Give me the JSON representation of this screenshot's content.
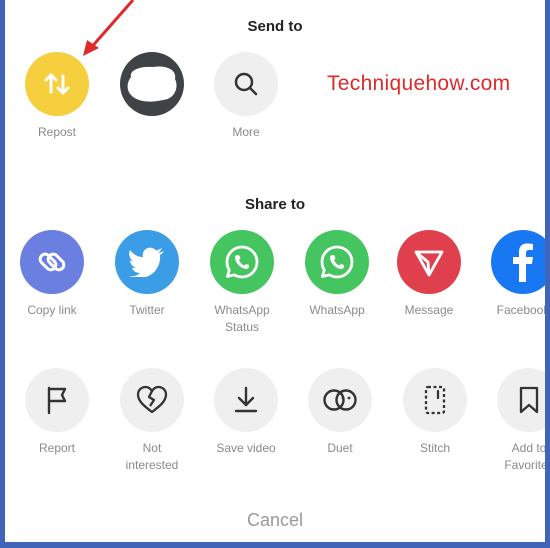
{
  "header": {
    "send_to": "Send to",
    "share_to": "Share to"
  },
  "watermark": "Techniquehow.com",
  "send_row": [
    {
      "label": "Repost",
      "icon": "repost-icon",
      "color": "#f5cf3e"
    },
    {
      "label": "",
      "icon": "contact-avatar",
      "color": "#3d4347"
    },
    {
      "label": "More",
      "icon": "search-icon",
      "color": "#efefef"
    }
  ],
  "share_row": [
    {
      "label": "Copy link",
      "icon": "link-icon",
      "color": "#6a7fe0"
    },
    {
      "label": "Twitter",
      "icon": "twitter-icon",
      "color": "#3a9de6"
    },
    {
      "label": "WhatsApp\nStatus",
      "icon": "whatsapp-icon",
      "color": "#45c560"
    },
    {
      "label": "WhatsApp",
      "icon": "whatsapp-icon",
      "color": "#45c560"
    },
    {
      "label": "Message",
      "icon": "send-icon",
      "color": "#e0404e"
    },
    {
      "label": "Facebook",
      "icon": "facebook-icon",
      "color": "#1877f2"
    }
  ],
  "action_row": [
    {
      "label": "Report",
      "icon": "flag-icon"
    },
    {
      "label": "Not\ninterested",
      "icon": "broken-heart-icon"
    },
    {
      "label": "Save video",
      "icon": "download-icon"
    },
    {
      "label": "Duet",
      "icon": "duet-icon"
    },
    {
      "label": "Stitch",
      "icon": "stitch-icon"
    },
    {
      "label": "Add to\nFavorites",
      "icon": "bookmark-icon"
    }
  ],
  "cancel_label": "Cancel"
}
